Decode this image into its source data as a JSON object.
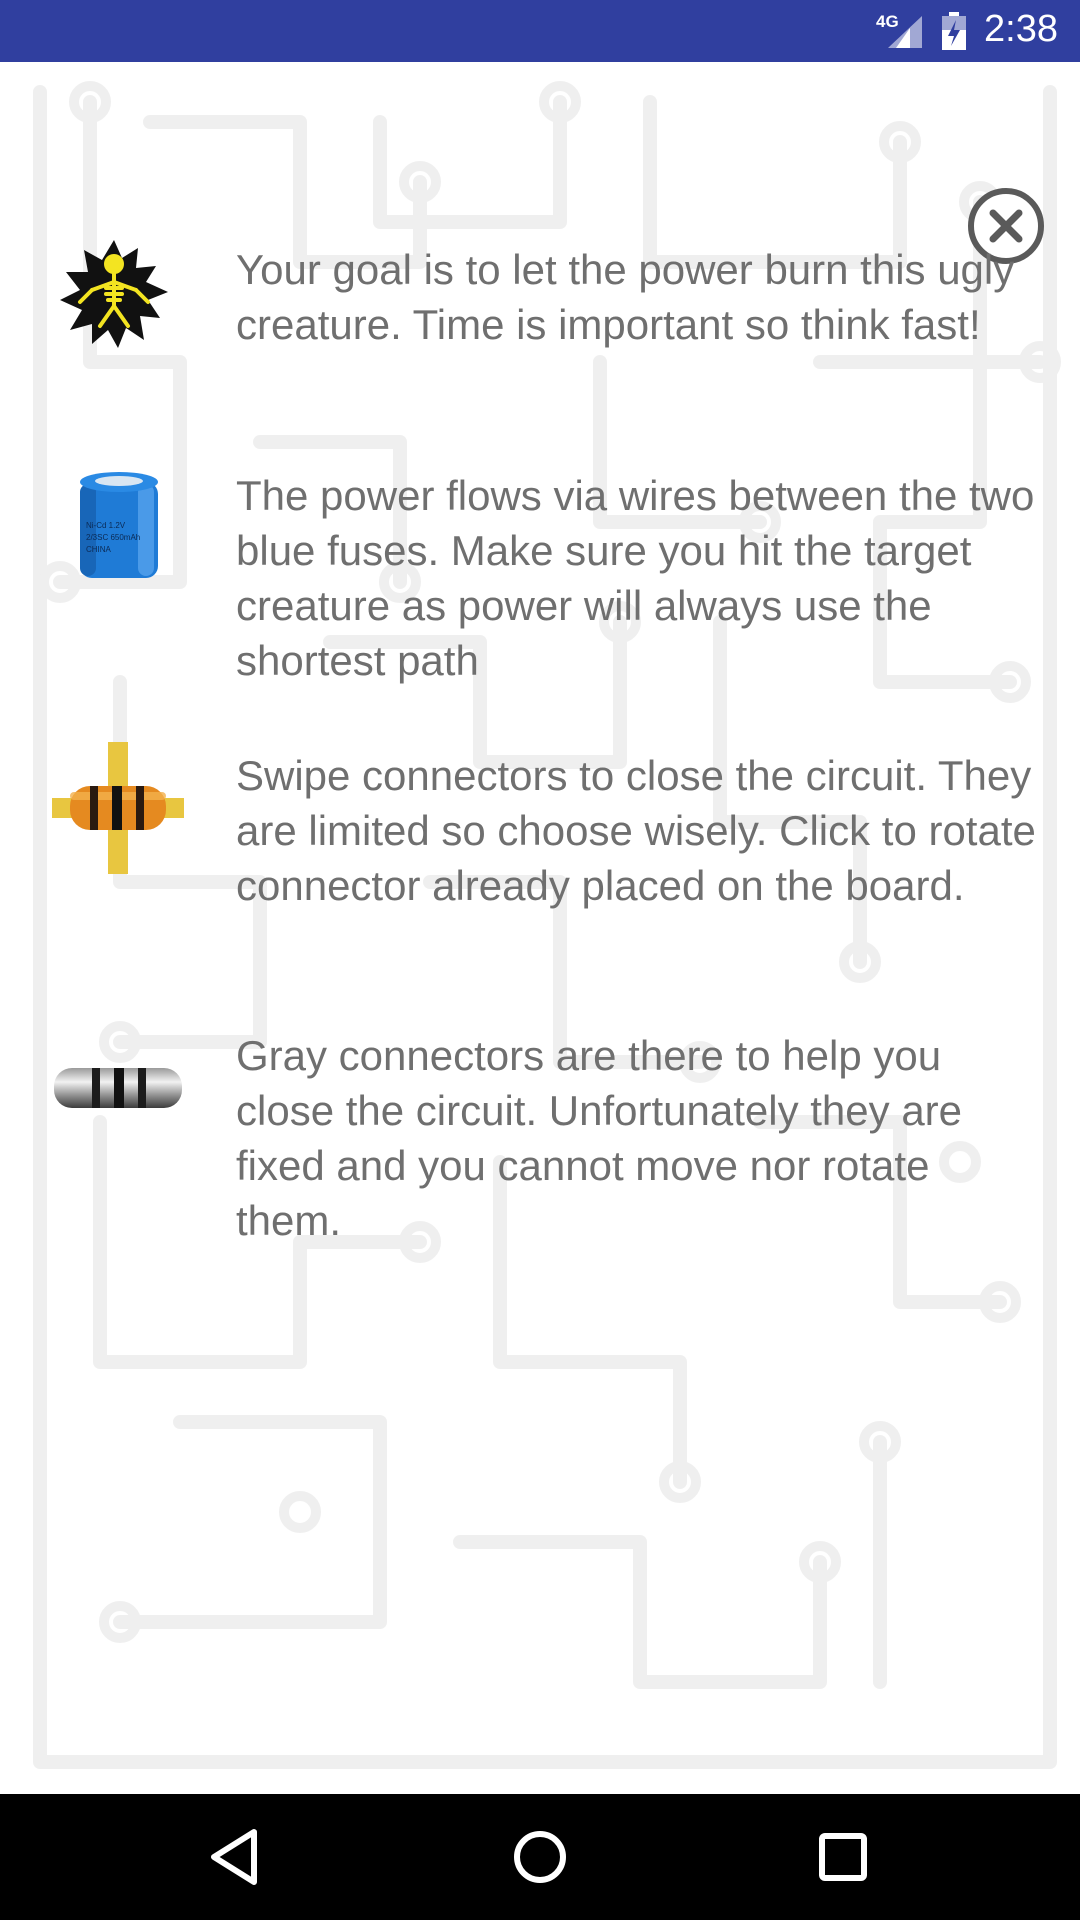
{
  "status_bar": {
    "network": "4G",
    "time": "2:38",
    "color": "#303f9f"
  },
  "close_icon": "close-circle-icon",
  "instructions": [
    {
      "icon": "burning-creature-icon",
      "text": "Your goal is to let the power burn this ugly creature. Time is important so think fast!"
    },
    {
      "icon": "blue-battery-fuse-icon",
      "icon_label": "Ni-Cd 1.2V 2/3SC 650mAh CHINA",
      "text": "The power flows via wires between the two blue fuses. Make sure you hit the target creature as power will always use the shortest path"
    },
    {
      "icon": "orange-resistor-connector-icon",
      "text": "Swipe connectors to close the circuit. They are limited so choose wisely. Click to rotate connector already placed on the board."
    },
    {
      "icon": "gray-resistor-connector-icon",
      "text": "Gray connectors are there to help you close the circuit. Unfortunately they are fixed and you cannot move nor rotate them."
    }
  ],
  "nav_bar": {
    "back_icon": "back-triangle-icon",
    "home_icon": "home-circle-icon",
    "recents_icon": "recents-square-icon"
  }
}
